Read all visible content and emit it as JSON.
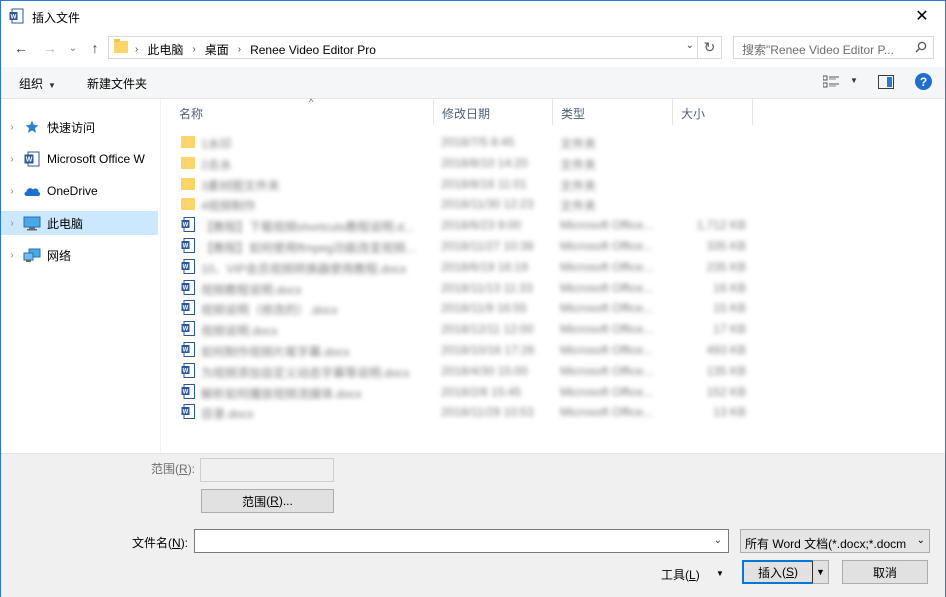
{
  "window": {
    "title": "插入文件",
    "close_glyph": "✕"
  },
  "nav": {
    "back_glyph": "←",
    "forward_glyph": "→",
    "recent_glyph": "⌄",
    "up_glyph": "↑",
    "breadcrumbs": [
      "此电脑",
      "桌面",
      "Renee Video Editor Pro"
    ],
    "crumb_sep": "›",
    "dropdown_glyph": "⌄",
    "refresh_glyph": "↻",
    "search_placeholder": "搜索\"Renee Video Editor P..."
  },
  "toolbar": {
    "organize_label": "组织",
    "new_folder_label": "新建文件夹",
    "caret": "▼",
    "help_glyph": "?"
  },
  "sidebar": {
    "items": [
      {
        "label": "快速访问",
        "icon": "star-icon"
      },
      {
        "label": "Microsoft Office W",
        "icon": "word-icon"
      },
      {
        "label": "OneDrive",
        "icon": "cloud-icon"
      },
      {
        "label": "此电脑",
        "icon": "computer-icon",
        "selected": true
      },
      {
        "label": "网络",
        "icon": "network-icon"
      }
    ],
    "chevron": "›"
  },
  "columns": {
    "name": "名称",
    "modified": "修改日期",
    "type": "类型",
    "size": "大小",
    "sort_glyph": "^"
  },
  "files": [
    {
      "kind": "folder",
      "name": "1水印",
      "date": "2018/7/5 8:45",
      "type": "文件夹",
      "size": ""
    },
    {
      "kind": "folder",
      "name": "2去水",
      "date": "2018/8/10 14:20",
      "type": "文件夹",
      "size": ""
    },
    {
      "kind": "folder",
      "name": "3素材图文件夹",
      "date": "2018/8/16 11:01",
      "type": "文件夹",
      "size": ""
    },
    {
      "kind": "folder",
      "name": "4视频制作",
      "date": "2018/11/30 12:23",
      "type": "文件夹",
      "size": ""
    },
    {
      "kind": "doc",
      "name": "【教程】下载视频shortcuts教程说明.d...",
      "date": "2018/6/23 9:00",
      "type": "Microsoft Office...",
      "size": "1,712 KB"
    },
    {
      "kind": "doc",
      "name": "【教程】如何使用ffmpeg功能改变视频...",
      "date": "2018/11/27 10:38",
      "type": "Microsoft Office...",
      "size": "335 KB"
    },
    {
      "kind": "doc",
      "name": "10、VIP会员视频转换器使用教程.docx",
      "date": "2018/6/19 16:19",
      "type": "Microsoft Office...",
      "size": "235 KB"
    },
    {
      "kind": "doc",
      "name": "视频教程说明.docx",
      "date": "2018/11/13 11:33",
      "type": "Microsoft Office...",
      "size": "16 KB"
    },
    {
      "kind": "doc",
      "name": "视频说明（修改的）.docx",
      "date": "2018/11/9 16:55",
      "type": "Microsoft Office...",
      "size": "15 KB"
    },
    {
      "kind": "doc",
      "name": "视频说明.docx",
      "date": "2018/12/11 12:00",
      "type": "Microsoft Office...",
      "size": "17 KB"
    },
    {
      "kind": "doc",
      "name": "如何制作视频片尾字幕.docx",
      "date": "2018/10/16 17:26",
      "type": "Microsoft Office...",
      "size": "493 KB"
    },
    {
      "kind": "doc",
      "name": "为视频添加自定义动态字幕等说明.docx",
      "date": "2018/4/30 15:00",
      "type": "Microsoft Office...",
      "size": "135 KB"
    },
    {
      "kind": "doc",
      "name": "解析如何播放视频流媒体.docx",
      "date": "2018/2/8 15:45",
      "type": "Microsoft Office...",
      "size": "152 KB"
    },
    {
      "kind": "doc",
      "name": "目录.docx",
      "date": "2018/11/29 10:53",
      "type": "Microsoft Office...",
      "size": "13 KB"
    }
  ],
  "bottom": {
    "range_label": "范围",
    "range_key": "R",
    "range_button": "范围",
    "range_button_key": "R",
    "range_button_suffix": "...",
    "filename_label": "文件名",
    "filename_key": "N",
    "filename_value": "",
    "filetype_value": "所有 Word 文档(*.docx;*.docm",
    "tools_label": "工具",
    "tools_key": "L",
    "insert_label": "插入",
    "insert_key": "S",
    "cancel_label": "取消"
  },
  "colors": {
    "accent": "#0078d7",
    "selection": "#cce8ff",
    "folder": "#fbd46a"
  }
}
